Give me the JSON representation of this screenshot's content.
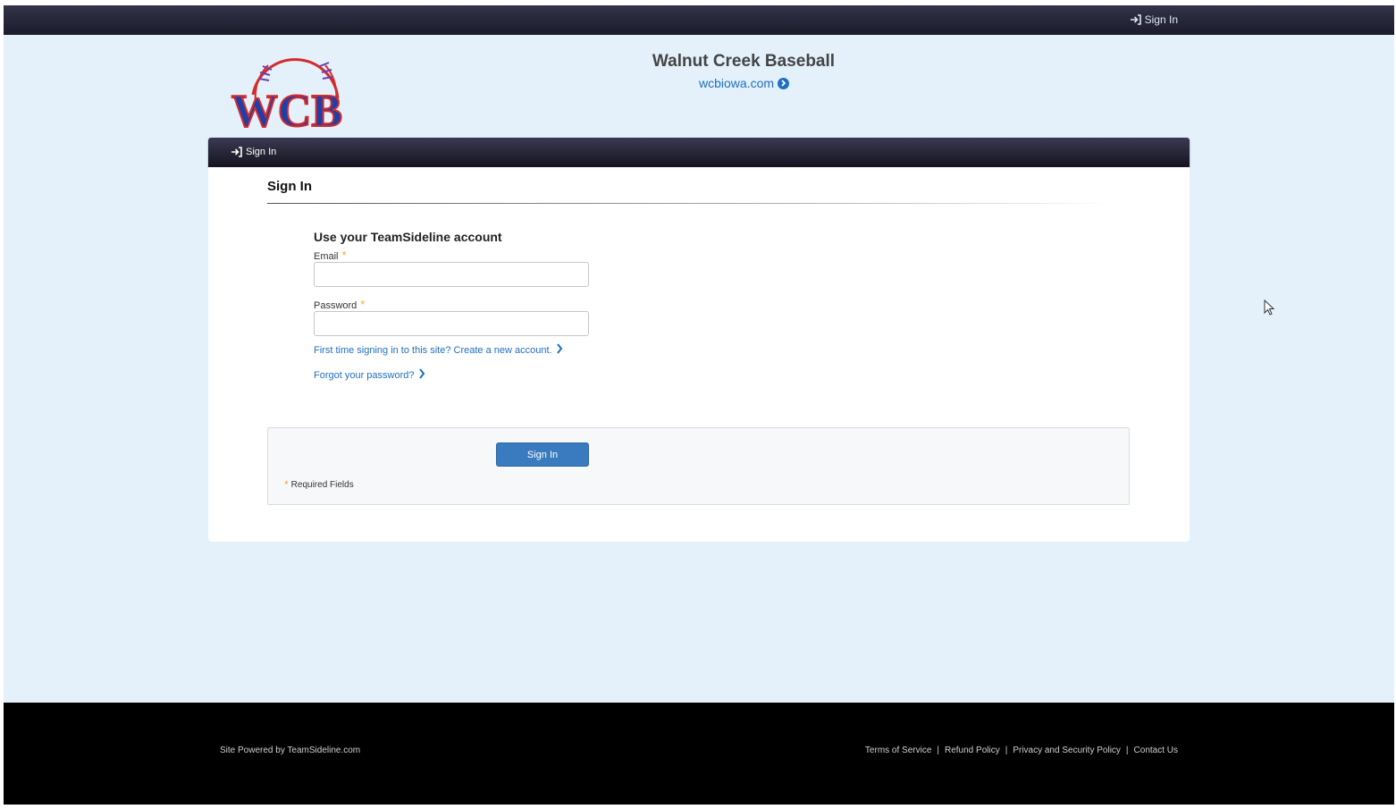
{
  "topbar": {
    "signin_label": "Sign In"
  },
  "header": {
    "logo_text": "WCB",
    "site_title": "Walnut Creek Baseball",
    "site_link": "wcbiowa.com"
  },
  "nav": {
    "signin_label": "Sign In"
  },
  "page": {
    "heading": "Sign In",
    "form_heading": "Use your TeamSideline account",
    "email_label": "Email",
    "password_label": "Password",
    "required_marker": "*",
    "email_value": "",
    "password_value": "",
    "create_account_link": "First time signing in to this site?  Create a new account.",
    "forgot_password_link": "Forgot your password?",
    "submit_label": "Sign In",
    "required_note": "Required Fields"
  },
  "footer": {
    "powered_by": "Site Powered by TeamSideline.com",
    "links": [
      "Terms of Service",
      "Refund Policy",
      "Privacy and Security Policy",
      "Contact Us"
    ],
    "separator": "|"
  },
  "colors": {
    "page_bg": "#e4f1fb",
    "nav_dark": "#1b1b2c",
    "link_blue": "#1f6fc2",
    "button_blue": "#3a7bbf",
    "required_orange": "#f0a830",
    "logo_blue": "#1f3fa8",
    "logo_red": "#d42b2b"
  },
  "icons": [
    "sign-in-icon",
    "circle-chevron-right-icon",
    "chevron-right-icon",
    "asterisk-icon",
    "mouse-cursor-icon"
  ]
}
